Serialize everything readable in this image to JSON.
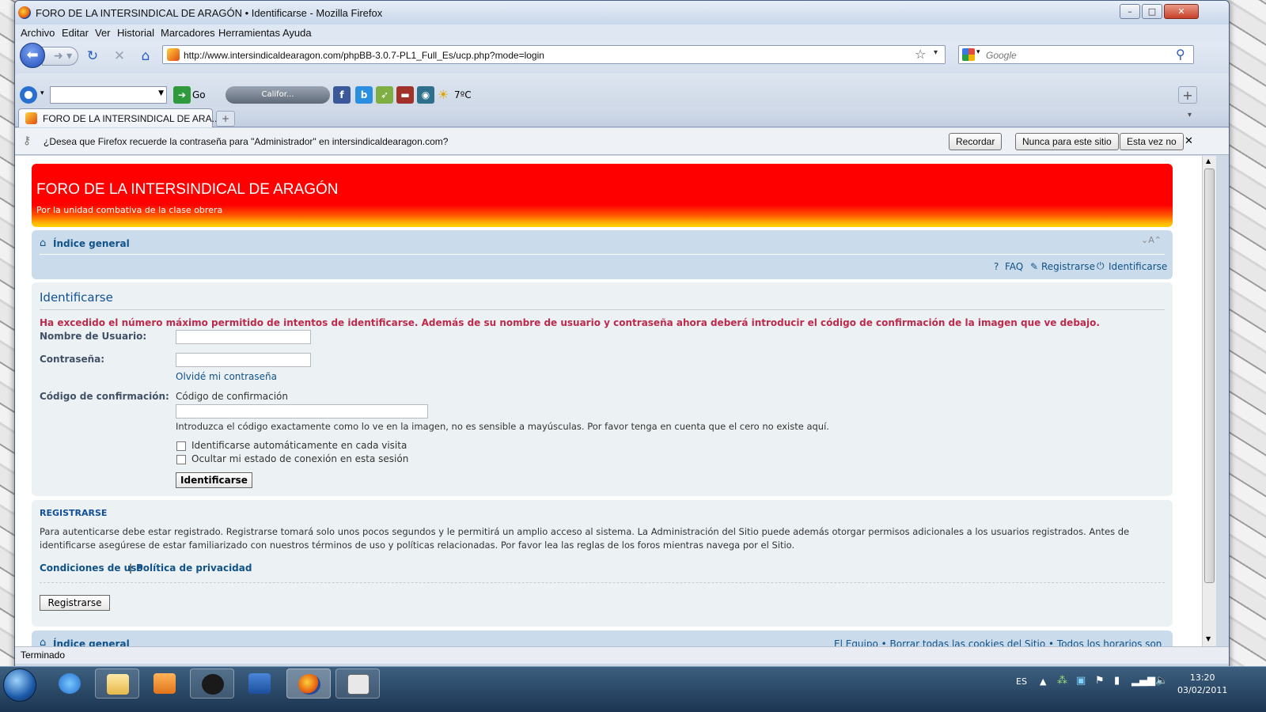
{
  "window": {
    "title": "FORO DE LA INTERSINDICAL DE ARAGÓN • Identificarse - Mozilla Firefox"
  },
  "menu": [
    "Archivo",
    "Editar",
    "Ver",
    "Historial",
    "Marcadores",
    "Herramientas",
    "Ayuda"
  ],
  "nav": {
    "url": "http://www.intersindicaldearagon.com/phpBB-3.0.7-PL1_Full_Es/ucp.php?mode=login",
    "search_placeholder": "Google"
  },
  "toolbar2": {
    "go_label": "Go",
    "radio_label": "Califor...",
    "weather": "7ºC"
  },
  "tab": {
    "label": "FORO DE LA INTERSINDICAL DE ARA..."
  },
  "notification": {
    "text": "¿Desea que Firefox recuerde la contraseña para \"Administrador\" en intersindicaldearagon.com?",
    "remember": "Recordar",
    "never": "Nunca para este sitio",
    "not_now": "Esta vez no"
  },
  "page": {
    "site_title": "FORO DE LA INTERSINDICAL DE ARAGÓN",
    "site_desc": "Por la unidad combativa de la clase obrera",
    "breadcrumb": "Índice general",
    "font_toggle": "A",
    "links": {
      "faq": "FAQ",
      "register": "Registrarse",
      "login": "Identificarse"
    },
    "login": {
      "title": "Identificarse",
      "error": "Ha excedido el número máximo permitido de intentos de identificarse. Además de su nombre de usuario y contraseña ahora deberá introducir el código de confirmación de la imagen que ve debajo.",
      "username_label": "Nombre de Usuario:",
      "password_label": "Contraseña:",
      "forgot": "Olvidé mi contraseña",
      "confirm_label": "Código de confirmación:",
      "confirm_img_alt": "Código de confirmación",
      "confirm_help": "Introduzca el código exactamente como lo ve en la imagen, no es sensible a mayúsculas. Por favor tenga en cuenta que el cero no existe aquí.",
      "autologin": "Identificarse automáticamente en cada visita",
      "hide_online": "Ocultar mi estado de conexión en esta sesión",
      "submit": "Identificarse"
    },
    "register": {
      "title": "REGISTRARSE",
      "text": "Para autenticarse debe estar registrado. Registrarse tomará solo unos pocos segundos y le permitirá un amplio acceso al sistema. La Administración del Sitio puede además otorgar permisos adicionales a los usuarios registrados. Antes de identificarse asegúrese de estar familiarizado con nuestros términos de uso y políticas relacionadas. Por favor lea las reglas de los foros mientras navega por el Sitio.",
      "terms": "Condiciones de uso",
      "privacy": "Política de privacidad",
      "button": "Registrarse"
    },
    "footer": {
      "breadcrumb": "Índice general",
      "links": "El Equipo • Borrar todas las cookies del Sitio • Todos los horarios son UTC"
    }
  },
  "status": "Terminado",
  "taskbar": {
    "lang": "ES",
    "time": "13:20",
    "date": "03/02/2011"
  }
}
